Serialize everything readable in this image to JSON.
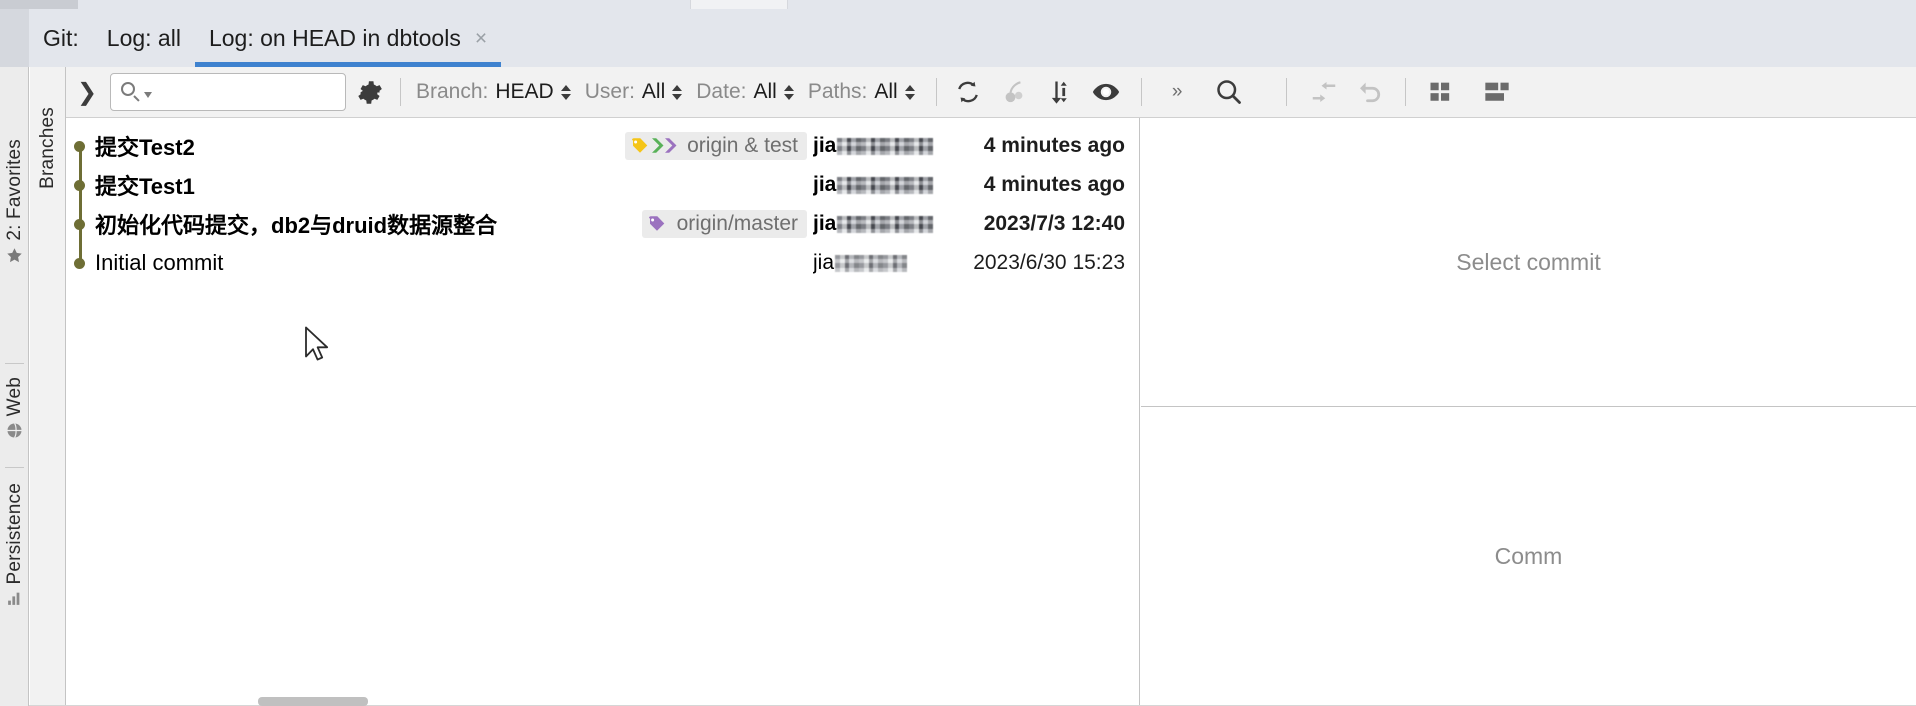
{
  "window": {
    "left_tool_strip": [
      {
        "label": "2: Favorites",
        "icon": "star-icon"
      },
      {
        "label": "Web",
        "icon": "globe-icon"
      },
      {
        "label": "Persistence",
        "icon": "database-icon"
      }
    ],
    "branches_strip": {
      "label": "Branches"
    }
  },
  "tabbar": {
    "group_label": "Git:",
    "tabs": [
      {
        "label": "Log: all",
        "active": false,
        "closable": false
      },
      {
        "label": "Log: on HEAD in dbtools",
        "active": true,
        "closable": true,
        "close_glyph": "×"
      }
    ],
    "active_underline_color": "#3f82cf"
  },
  "toolbar": {
    "expander_icon": "chevron-right-icon",
    "expander_glyph": "❯",
    "search": {
      "value": "",
      "placeholder": ""
    },
    "settings_icon": "gear-icon",
    "filters": [
      {
        "name": "branch-filter",
        "key": "Branch:",
        "value": "HEAD"
      },
      {
        "name": "user-filter",
        "key": "User:",
        "value": "All"
      },
      {
        "name": "date-filter",
        "key": "Date:",
        "value": "All"
      },
      {
        "name": "paths-filter",
        "key": "Paths:",
        "value": "All"
      }
    ],
    "actions": [
      {
        "name": "refresh-icon",
        "enabled": true
      },
      {
        "name": "cherry-pick-icon",
        "enabled": false
      },
      {
        "name": "intellisort-icon",
        "enabled": true
      },
      {
        "name": "show-details-eye-icon",
        "enabled": true
      },
      {
        "name": "more-options-icon",
        "enabled": true,
        "glyph": "»"
      },
      {
        "name": "search-icon",
        "enabled": true
      }
    ],
    "right_actions": [
      {
        "name": "go-to-hash-icon",
        "enabled": false
      },
      {
        "name": "undo-icon",
        "enabled": false
      },
      {
        "name": "layout-grid-icon",
        "enabled": true
      },
      {
        "name": "layout-split-icon",
        "enabled": true
      }
    ]
  },
  "commits": [
    {
      "subject": "提交Test2",
      "bold": true,
      "refs": [
        {
          "label": "origin & test",
          "icons": [
            "tag-yellow-icon",
            "branch-green-icon",
            "branch-purple-icon"
          ]
        }
      ],
      "author_visible": "jia",
      "author_redacted": true,
      "date": "4 minutes ago",
      "date_bold": true
    },
    {
      "subject": "提交Test1",
      "bold": true,
      "refs": [],
      "author_visible": "jia",
      "author_redacted": true,
      "date": "4 minutes ago",
      "date_bold": true
    },
    {
      "subject": "初始化代码提交，db2与druid数据源整合",
      "bold": true,
      "refs": [
        {
          "label": "origin/master",
          "icons": [
            "tag-purple-icon"
          ]
        }
      ],
      "author_visible": "jia",
      "author_redacted": true,
      "date": "2023/7/3 12:40",
      "date_bold": true
    },
    {
      "subject": "Initial commit",
      "bold": false,
      "refs": [],
      "author_visible": "jia",
      "author_redacted": true,
      "date": "2023/6/30 15:23",
      "date_bold": false
    }
  ],
  "detail_pane": {
    "empty_selection_text": "Select commit",
    "commit_details_text": "Comm"
  },
  "colors": {
    "graph_node": "#6e6e35",
    "tab_accent": "#3f82cf",
    "ref_yellow": "#f5c518",
    "ref_green": "#59b159",
    "ref_purple": "#9b72bf",
    "toolbar_bg": "#f2f2f2",
    "tabbar_bg": "#e3e6ec"
  }
}
